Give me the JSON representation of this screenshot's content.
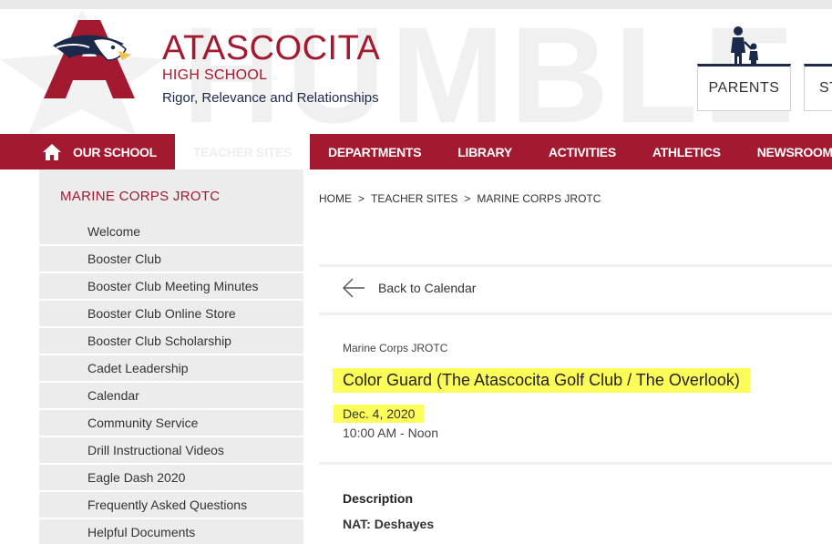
{
  "header": {
    "watermark": "HUMBLE",
    "school_name": "ATASCOCITA",
    "school_sub": "HIGH SCHOOL",
    "motto": "Rigor, Relevance and Relationships",
    "audience_buttons": [
      "PARENTS",
      "ST"
    ]
  },
  "nav": {
    "items": [
      "OUR SCHOOL",
      "TEACHER SITES",
      "DEPARTMENTS",
      "LIBRARY",
      "ACTIVITIES",
      "ATHLETICS",
      "NEWSROOM"
    ],
    "active": "TEACHER SITES"
  },
  "sidebar": {
    "title": "MARINE CORPS JROTC",
    "items": [
      "Welcome",
      "Booster Club",
      "Booster Club Meeting Minutes",
      "Booster Club Online Store",
      "Booster Club Scholarship",
      "Cadet Leadership",
      "Calendar",
      "Community Service",
      "Drill Instructional Videos",
      "Eagle Dash 2020",
      "Frequently Asked Questions",
      "Helpful Documents"
    ]
  },
  "breadcrumb": {
    "items": [
      "HOME",
      "TEACHER SITES",
      "MARINE CORPS JROTC"
    ],
    "separator": ">"
  },
  "event": {
    "back_label": "Back to Calendar",
    "category": "Marine Corps JROTC",
    "title": "Color Guard (The Atascocita Golf Club / The Overlook)",
    "date": "Dec. 4, 2020",
    "time": "10:00 AM - Noon",
    "description_label": "Description",
    "description": "NAT: Deshayes"
  },
  "colors": {
    "brand_red": "#a3192f",
    "navy": "#1b2a4a",
    "highlight": "#fdfd5a",
    "sidebar_bg": "#ececec"
  },
  "icons": {
    "home": "home-icon",
    "family": "family-icon",
    "back": "arrow-left-icon",
    "logo": "eagle-logo"
  }
}
